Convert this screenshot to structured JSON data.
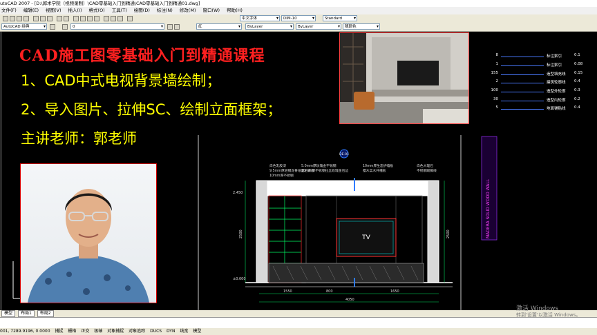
{
  "window": {
    "title": "utoCAD 2007 - [D:\\郭术学院（视频录制）\\CAD零基础入门到精通\\CAD零基础入门到精通01.dwg]"
  },
  "menu": {
    "items": [
      "文件(F)",
      "编辑(E)",
      "视图(V)",
      "插入(I)",
      "格式(O)",
      "工具(T)",
      "绘图(D)",
      "标注(N)",
      "修改(M)",
      "窗口(W)",
      "帮助(H)"
    ]
  },
  "toolbar": {
    "workspace_value": "AutoCAD 经典",
    "layer_value": "0",
    "color_value": "红",
    "linetype_value": "ByLayer",
    "lineweight_value": "ByLayer",
    "plotstyle_value": "随颜色",
    "textstyle_value": "中文字体",
    "dimstyle_value": "DIM-10",
    "tablestyle_value": "Standard"
  },
  "overlay": {
    "course_title": "CAD施工图零基础入门到精通课程",
    "lesson_1": "1、CAD中式电视背景墙绘制；",
    "lesson_2": "2、导入图片、拉伸SC、绘制立面框架；",
    "instructor": "主讲老师：郭老师"
  },
  "legend": [
    {
      "pre": "8",
      "name": "标注索引",
      "weight": "0.1"
    },
    {
      "pre": "1",
      "name": "标注索引",
      "weight": "0.08"
    },
    {
      "pre": "155",
      "name": "造型填充线",
      "weight": "0.15"
    },
    {
      "pre": "2",
      "name": "建筑轮廓线",
      "weight": "0.4"
    },
    {
      "pre": "100",
      "name": "造型外轮廓",
      "weight": "0.3"
    },
    {
      "pre": "30",
      "name": "造型内轮廓",
      "weight": "0.2"
    },
    {
      "pre": "5",
      "name": "地面铺贴线",
      "weight": "0.4"
    }
  ],
  "drawing": {
    "section_tag": "DE-01",
    "annotations_left": [
      "白色乳胶漆",
      "9.5mm厚轻钢龙骨纸面石膏板",
      "10mm厚不锈钢"
    ],
    "annotations_mid": [
      "5.0mm厚玫瑰金不锈钢",
      "10mm厚不锈钢拉丝玫瑰金包边"
    ],
    "annotations_right_1": [
      "10mm厚生态护墙板",
      "樱木实木开槽板"
    ],
    "annotations_right_2": [
      "白色大理石",
      "不锈钢踢脚线"
    ],
    "tv_label": "TV",
    "level_top": "2.450",
    "level_bottom": "±0.000",
    "dims_bottom": [
      "1550",
      "800",
      "1650"
    ],
    "dim_total": "4050",
    "dim_left_vertical": "2500",
    "dim_right_vertical": "2500",
    "vertical_text": "MADERA SOLID WOOD WALL"
  },
  "tabs": {
    "items": [
      "模型",
      "布局1",
      "布局2"
    ]
  },
  "status": {
    "coords": "001,    7289.9196, 0.0000",
    "toggles": [
      "捕捉",
      "栅格",
      "正交",
      "极轴",
      "对象捕捉",
      "对象追踪",
      "DUCS",
      "DYN",
      "线宽",
      "模型"
    ]
  },
  "watermark": {
    "line1": "激活 Windows",
    "line2": "转到'设置'以激活 Windows。"
  }
}
